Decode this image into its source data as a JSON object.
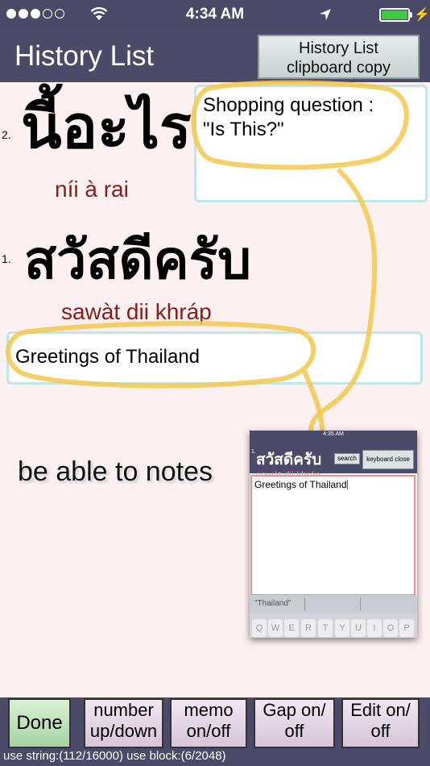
{
  "status_bar": {
    "time": "4:34 AM",
    "signal_dots_filled": 3,
    "signal_dots_total": 5,
    "battery_level": 1.0,
    "icons": [
      "wifi-icon",
      "location-arrow-icon",
      "battery-icon",
      "charging-bolt-icon"
    ]
  },
  "header": {
    "title": "History List",
    "copy_button": [
      "History List",
      "clipboard copy"
    ]
  },
  "entries": [
    {
      "number": "2.",
      "thai": "นี้อะไร",
      "translit": "níi à rai",
      "note": [
        "Shopping question :",
        "\"Is This?\""
      ]
    },
    {
      "number": "1.",
      "thai": "สวัสดีครับ",
      "translit": "sawàt dii khráp",
      "note": [
        "Greetings of Thailand"
      ]
    }
  ],
  "annotation": {
    "caption": "be able to notes",
    "highlight_color": "#f2c84b"
  },
  "inset": {
    "time": "4:35 AM",
    "number": "1.",
    "thai": "สวัสดีครับ",
    "translit": "sawàt dii khráp",
    "search_label": "search",
    "keyboard_close_label": "keyboard close",
    "note_text": "Greetings of Thailand",
    "suggestion": "\"Thailand\"",
    "keys": [
      "Q",
      "W",
      "E",
      "R",
      "T",
      "Y",
      "U",
      "I",
      "O",
      "P"
    ]
  },
  "toolbar": {
    "done": "Done",
    "number_updown": [
      "number",
      "up/down"
    ],
    "memo": [
      "memo",
      "on/off"
    ],
    "gap": [
      "Gap on/",
      "off"
    ],
    "edit": [
      "Edit on/",
      "off"
    ],
    "usage": "use string:(112/16000) use block:(6/2048)"
  },
  "colors": {
    "bar_bg": "#4b4b69",
    "page_bg": "#fdf0f0",
    "translit": "#8b1a1a",
    "done_green": "#bfe6b9"
  }
}
